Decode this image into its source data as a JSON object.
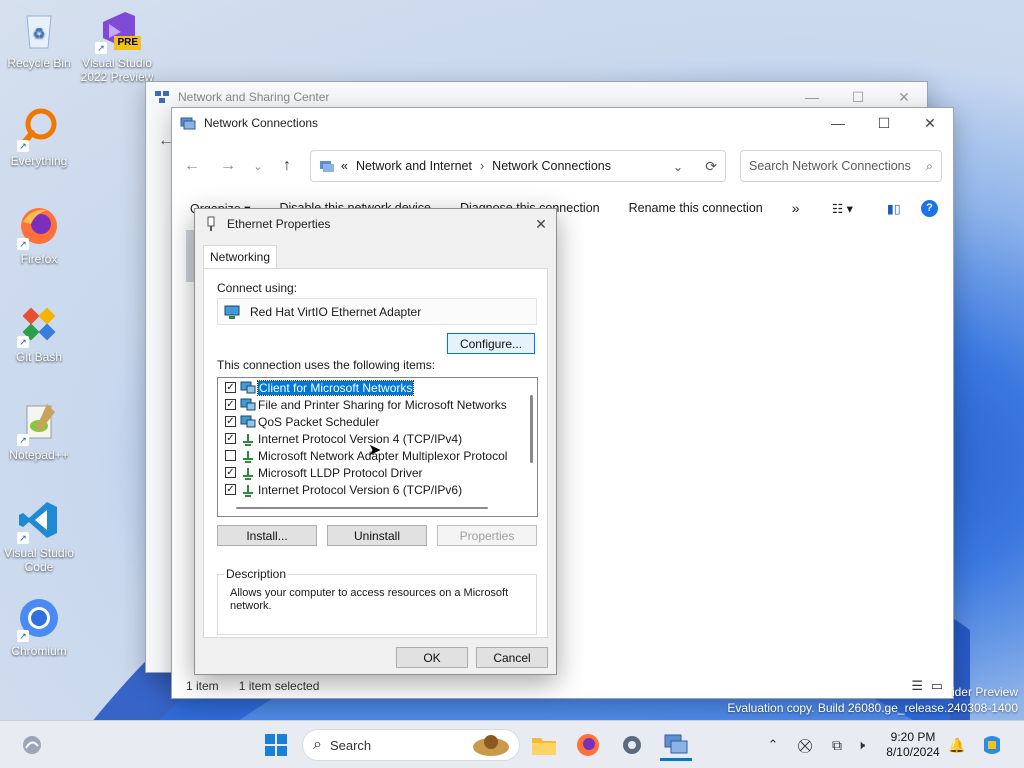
{
  "desktop": {
    "icons": [
      {
        "label": "Recycle Bin"
      },
      {
        "label": "Visual Studio 2022 Preview",
        "badge": "PRE"
      },
      {
        "label": "Everything"
      },
      {
        "label": "Firefox"
      },
      {
        "label": "Git Bash"
      },
      {
        "label": "Notepad++"
      },
      {
        "label": "Visual Studio Code"
      },
      {
        "label": "Chromium"
      }
    ],
    "watermark_line1": "ider Preview",
    "watermark_line2": "Evaluation copy. Build 26080.ge_release.240308-1400"
  },
  "sharing_center": {
    "title": "Network and Sharing Center"
  },
  "net_connections": {
    "title": "Network Connections",
    "breadcrumb_prefix": "«",
    "breadcrumb": [
      "Network and Internet",
      "Network Connections"
    ],
    "search_placeholder": "Search Network Connections",
    "commands": [
      "Organize ▾",
      "Disable this network device",
      "Diagnose this connection",
      "Rename this connection",
      "»"
    ],
    "status_count": "1 item",
    "status_selected": "1 item selected"
  },
  "dialog": {
    "title": "Ethernet Properties",
    "tab": "Networking",
    "connect_using_label": "Connect using:",
    "adapter_name": "Red Hat VirtIO Ethernet Adapter",
    "configure_label": "Configure...",
    "items_label": "This connection uses the following items:",
    "items": [
      {
        "text": "Client for Microsoft Networks",
        "checked": true,
        "selected": true,
        "icon": "network-client-icon"
      },
      {
        "text": "File and Printer Sharing for Microsoft Networks",
        "checked": true,
        "selected": false,
        "icon": "network-client-icon"
      },
      {
        "text": "QoS Packet Scheduler",
        "checked": true,
        "selected": false,
        "icon": "network-client-icon"
      },
      {
        "text": "Internet Protocol Version 4 (TCP/IPv4)",
        "checked": true,
        "selected": false,
        "icon": "protocol-icon"
      },
      {
        "text": "Microsoft Network Adapter Multiplexor Protocol",
        "checked": false,
        "selected": false,
        "icon": "protocol-icon"
      },
      {
        "text": "Microsoft LLDP Protocol Driver",
        "checked": true,
        "selected": false,
        "icon": "protocol-icon"
      },
      {
        "text": "Internet Protocol Version 6 (TCP/IPv6)",
        "checked": true,
        "selected": false,
        "icon": "protocol-icon"
      }
    ],
    "install_label": "Install...",
    "uninstall_label": "Uninstall",
    "properties_label": "Properties",
    "description_legend": "Description",
    "description_text": "Allows your computer to access resources on a Microsoft network.",
    "ok_label": "OK",
    "cancel_label": "Cancel"
  },
  "taskbar": {
    "search_label": "Search",
    "time": "9:20 PM",
    "date": "8/10/2024"
  },
  "colors": {
    "accent": "#0078d7",
    "help": "#1a73e8"
  }
}
